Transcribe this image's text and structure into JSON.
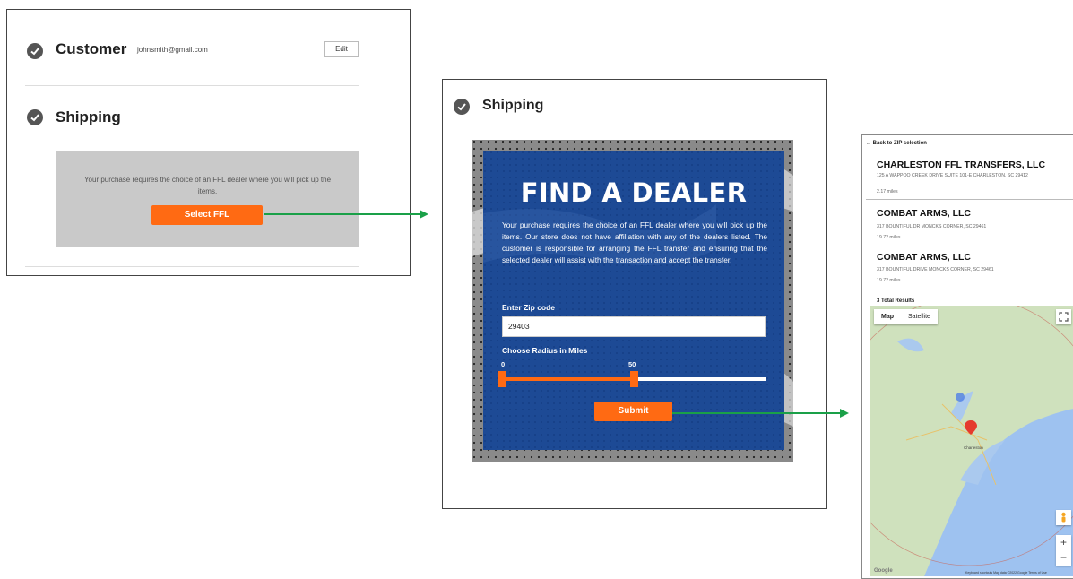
{
  "checkout": {
    "customer": {
      "title": "Customer",
      "email": "johnsmith@gmail.com",
      "edit_label": "Edit"
    },
    "shipping": {
      "title": "Shipping",
      "notice": "Your purchase requires the choice of an FFL dealer where you will pick up the items.",
      "select_button": "Select FFL"
    }
  },
  "dealer_form": {
    "step_title": "Shipping",
    "heading": "FIND A DEALER",
    "description": "Your purchase requires the choice of an FFL dealer where you will pick up the items. Our store does not have affiliation with any of the dealers listed. The customer is responsible for arranging the FFL transfer and ensuring that the selected dealer will assist with the transaction and accept the transfer.",
    "zip_label": "Enter Zip code",
    "zip_value": "29403",
    "radius_label": "Choose Radius in Miles",
    "radius_min": "0",
    "radius_value": "50",
    "submit_label": "Submit",
    "colors": {
      "accent": "#ff6a13",
      "panel_blue": "#1d4a95"
    }
  },
  "results": {
    "back_label": "← Back to ZIP selection",
    "items": [
      {
        "name": "CHARLESTON FFL TRANSFERS, LLC",
        "address": "125 A WAPPOO CREEK DRIVE SUITE 101-E CHARLESTON, SC 29412",
        "distance": "2.17 miles"
      },
      {
        "name": "COMBAT ARMS, LLC",
        "address": "317 BOUNTIFUL DR MONCKS CORNER, SC 29461",
        "distance": "19.72 miles"
      },
      {
        "name": "COMBAT ARMS, LLC",
        "address": "317 BOUNTIFUL DRIVE MONCKS CORNER, SC 29461",
        "distance": "19.72 miles"
      }
    ],
    "total": "3 Total Results",
    "map": {
      "tab_map": "Map",
      "tab_satellite": "Satellite",
      "city_label": "Charleston",
      "footer": "Keyboard shortcuts   Map data ©2022 Google   Terms of Use",
      "google_label": "Google",
      "zoom_in": "+",
      "zoom_out": "−"
    }
  }
}
